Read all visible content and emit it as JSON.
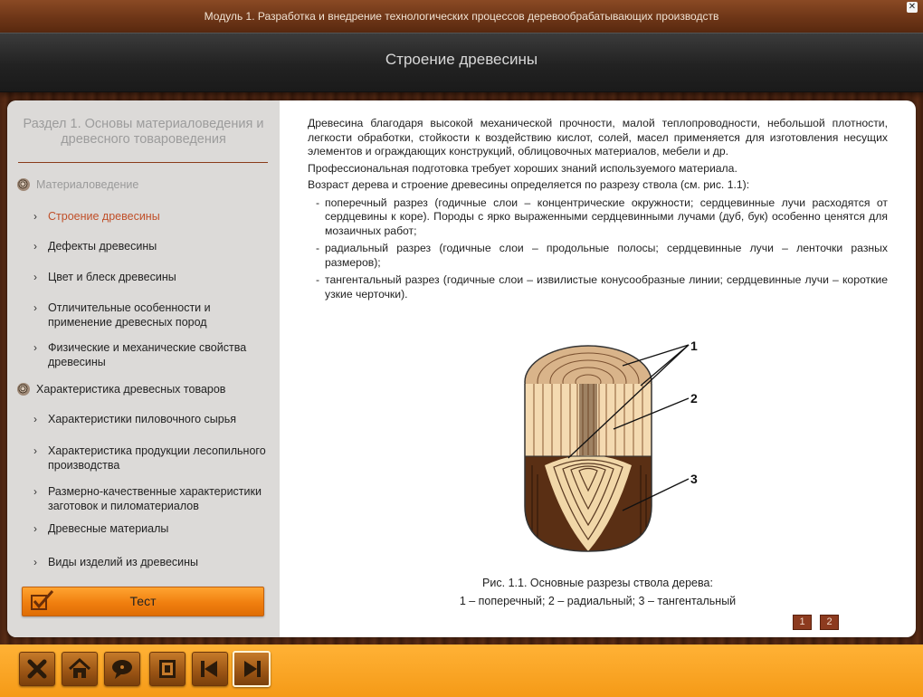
{
  "window": {
    "module_title": "Модуль 1. Разработка и внедрение технологических процессов деревообрабатывающих производств",
    "close_glyph": "✕"
  },
  "header": {
    "page_title": "Строение древесины"
  },
  "sidebar": {
    "section_title": "Раздел 1. Основы материаловедения и древесного товароведения",
    "groups": [
      {
        "label": "Материаловедение",
        "color": "#9a9a9a"
      },
      {
        "label": "Характеристика древесных товаров",
        "color": "#222222"
      }
    ],
    "items": [
      {
        "label": "Строение древесины",
        "active": true
      },
      {
        "label": "Дефекты древесины"
      },
      {
        "label": "Цвет и блеск древесины"
      },
      {
        "label": "Отличительные особенности и применение древесных пород"
      },
      {
        "label": "Физические и механические свойства древесины"
      },
      {
        "label": "Характеристики пиловочного сырья"
      },
      {
        "label": "Характеристика продукции лесопильного производства"
      },
      {
        "label": "Размерно-качественные характеристики заготовок и пиломатериалов"
      },
      {
        "label": "Древесные материалы"
      },
      {
        "label": "Виды изделий из древесины"
      }
    ],
    "test_button_label": "Тест"
  },
  "content": {
    "paragraphs": [
      "Древесина благодаря высокой механической прочности, малой теплопроводности, небольшой плотности, легкости обработки, стойкости к воздействию кислот, солей, масел применяется для изготовления несущих элементов и ограждающих конструкций, облицовочных материалов, мебели и др.",
      "Профессиональная подготовка требует хороших знаний используемого материала.",
      "Возраст дерева и строение древесины определяется по разрезу ствола (см. рис. 1.1):"
    ],
    "list": [
      "поперечный разрез (годичные слои – концентрические окружности; сердцевинные лучи расходятся от сердцевины к коре). Породы с ярко выраженными сердцевинными лучами (дуб, бук) особенно ценятся для мозаичных работ;",
      "радиальный разрез (годичные слои – продольные полосы; сердцевинные лучи – ленточки разных размеров);",
      "тангентальный разрез (годичные слои – извилистые конусообразные линии; сердцевинные лучи – короткие узкие черточки)."
    ],
    "figure_labels": [
      "1",
      "2",
      "3"
    ],
    "caption_line1": "Рис. 1.1. Основные разрезы ствола дерева:",
    "caption_line2": "1 – поперечный; 2 – радиальный; 3 – тангентальный",
    "pages": [
      "1",
      "2"
    ]
  },
  "toolbar": {
    "buttons": [
      {
        "name": "exit",
        "icon": "close-x-icon"
      },
      {
        "name": "home",
        "icon": "home-icon"
      },
      {
        "name": "help",
        "icon": "chat-icon"
      },
      {
        "name": "glossary",
        "icon": "book-icon"
      },
      {
        "name": "back",
        "icon": "arrow-left-icon"
      },
      {
        "name": "forward",
        "icon": "arrow-right-icon"
      }
    ]
  },
  "colors": {
    "accent_orange": "#f5a01f",
    "active_item": "#c0502a",
    "wood_dark": "#4a2311"
  }
}
